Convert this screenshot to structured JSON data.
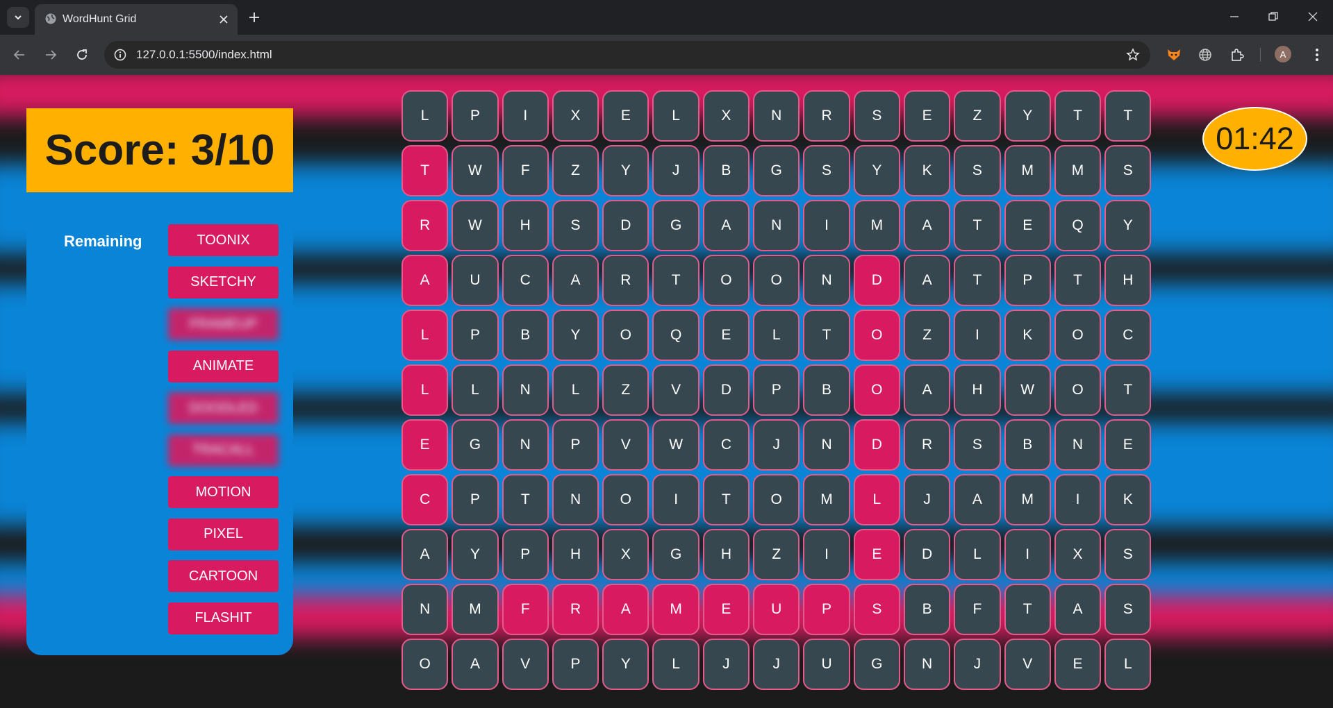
{
  "browser": {
    "tab_title": "WordHunt Grid",
    "url": "127.0.0.1:5500/index.html",
    "avatar_initial": "A"
  },
  "game": {
    "score_text": "Score: 3/10",
    "remaining_label": "Remaining",
    "timer": "01:42",
    "colors": {
      "score_bg": "#ffb000",
      "panel_bg": "#0a84d6",
      "accent_pink": "#d81b60",
      "cell_bg": "#37474f"
    },
    "words": [
      {
        "label": "TOONIX",
        "found": false
      },
      {
        "label": "SKETCHY",
        "found": false
      },
      {
        "label": "FRAMEUP",
        "found": true
      },
      {
        "label": "ANIMATE",
        "found": false
      },
      {
        "label": "DOODLED",
        "found": true
      },
      {
        "label": "TRACALL",
        "found": true
      },
      {
        "label": "MOTION",
        "found": false
      },
      {
        "label": "PIXEL",
        "found": false
      },
      {
        "label": "CARTOON",
        "found": false
      },
      {
        "label": "FLASHIT",
        "found": false
      }
    ],
    "grid": [
      "LPIXELXNRSEZYTT",
      "TWFZYJBGSYKSMMS",
      "RWHSDGANIMATEQY",
      "AUCARTOONDATPTH",
      "LPBYOQELTOZIKOC",
      "LLNLZVDPBOAHWOT",
      "EGNPVWCJNDRSBNE",
      "CPTNOITOMLJAMIK",
      "AYPHXGHZIEDLIXS",
      "NMFRAMEUPSBFTAS",
      "OAVPYLJJUGNJVEL"
    ],
    "highlighted_cells": [
      [
        1,
        0
      ],
      [
        2,
        0
      ],
      [
        3,
        0
      ],
      [
        4,
        0
      ],
      [
        5,
        0
      ],
      [
        6,
        0
      ],
      [
        7,
        0
      ],
      [
        3,
        9
      ],
      [
        4,
        9
      ],
      [
        5,
        9
      ],
      [
        6,
        9
      ],
      [
        7,
        9
      ],
      [
        8,
        9
      ],
      [
        9,
        9
      ],
      [
        9,
        2
      ],
      [
        9,
        3
      ],
      [
        9,
        4
      ],
      [
        9,
        5
      ],
      [
        9,
        6
      ],
      [
        9,
        7
      ],
      [
        9,
        8
      ]
    ]
  }
}
